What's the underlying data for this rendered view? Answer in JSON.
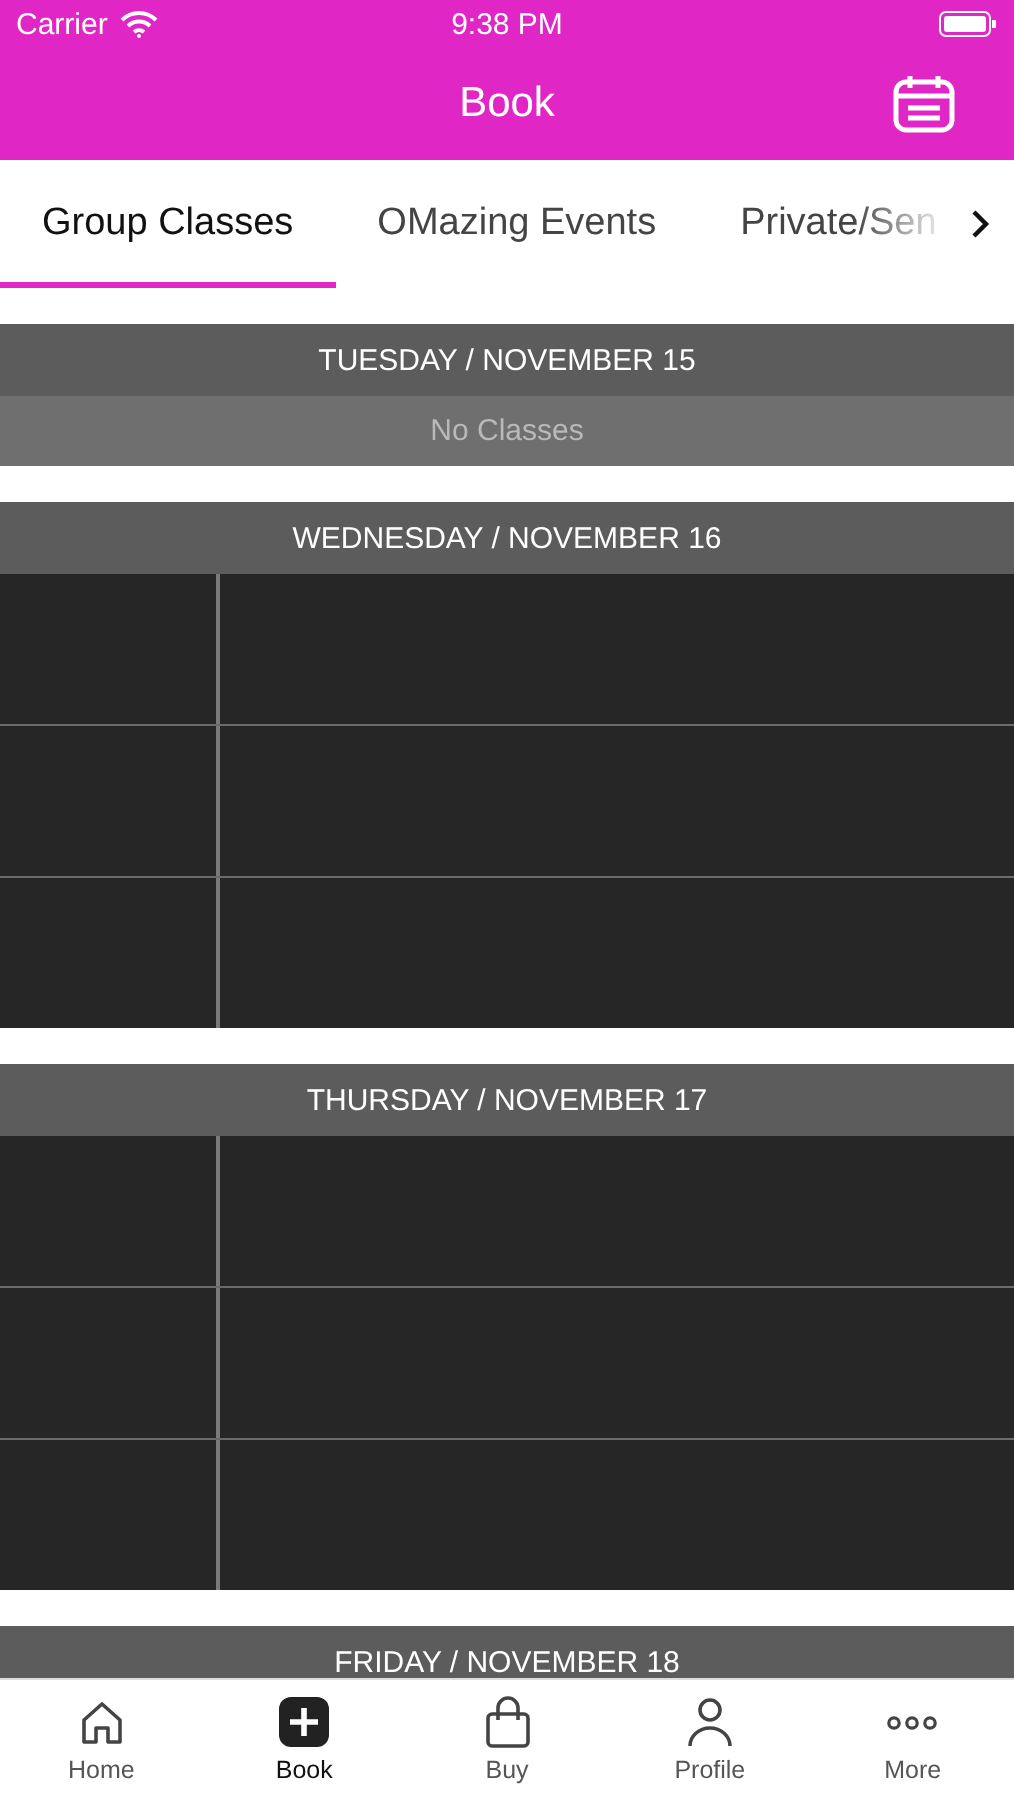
{
  "status_bar": {
    "carrier": "Carrier",
    "time": "9:38 PM"
  },
  "nav_bar": {
    "title": "Book"
  },
  "tabs": [
    {
      "label": "Group Classes",
      "selected": true
    },
    {
      "label": "OMazing Events",
      "selected": false
    },
    {
      "label": "Private/Sen",
      "selected": false
    }
  ],
  "days": [
    {
      "header": "TUESDAY / NOVEMBER 15",
      "empty_text": "No Classes"
    },
    {
      "header": "WEDNESDAY / NOVEMBER 16",
      "rows": [
        {
          "kind": "class"
        },
        {
          "kind": "class"
        },
        {
          "kind": "class"
        }
      ]
    },
    {
      "header": "THURSDAY / NOVEMBER 17",
      "rows": [
        {
          "kind": "class"
        },
        {
          "kind": "class"
        },
        {
          "kind": "class"
        }
      ]
    },
    {
      "header": "FRIDAY / NOVEMBER 18"
    }
  ],
  "tab_bar": [
    {
      "label": "Home",
      "selected": false
    },
    {
      "label": "Book",
      "selected": true
    },
    {
      "label": "Buy",
      "selected": false
    },
    {
      "label": "Profile",
      "selected": false
    },
    {
      "label": "More",
      "selected": false
    }
  ]
}
